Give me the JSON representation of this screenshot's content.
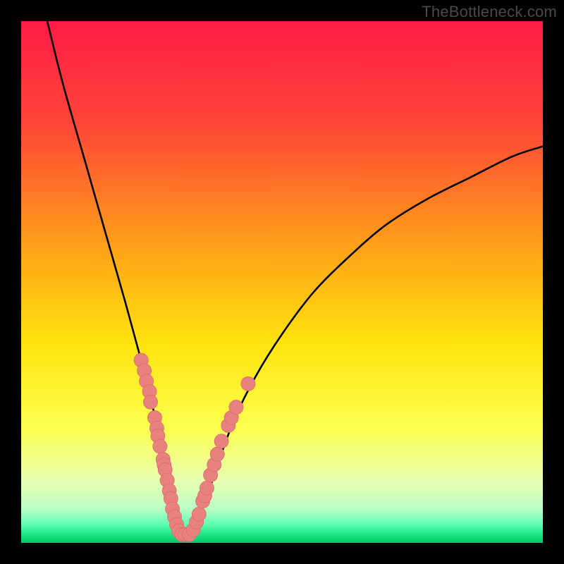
{
  "watermark": {
    "text": "TheBottleneck.com"
  },
  "colors": {
    "frame": "#000000",
    "curve": "#000000",
    "dot_fill": "#e9817f",
    "dot_stroke": "#d86f6d",
    "gradient_stops": [
      {
        "offset": 0.0,
        "color": "#ff1b46"
      },
      {
        "offset": 0.2,
        "color": "#ff4637"
      },
      {
        "offset": 0.45,
        "color": "#ffa716"
      },
      {
        "offset": 0.62,
        "color": "#ffe40f"
      },
      {
        "offset": 0.78,
        "color": "#fbff4e"
      },
      {
        "offset": 0.88,
        "color": "#e9ffb0"
      },
      {
        "offset": 0.935,
        "color": "#b9ffc4"
      },
      {
        "offset": 0.965,
        "color": "#5fffb3"
      },
      {
        "offset": 0.985,
        "color": "#17e57f"
      },
      {
        "offset": 1.0,
        "color": "#00c867"
      }
    ]
  },
  "chart_data": {
    "type": "line",
    "title": "",
    "xlabel": "",
    "ylabel": "",
    "xlim": [
      0,
      100
    ],
    "ylim": [
      0,
      100
    ],
    "series": [
      {
        "name": "bottleneck-curve",
        "x": [
          5,
          8,
          12,
          16,
          20,
          23,
          25,
          27,
          29,
          30,
          31,
          32,
          34,
          36,
          38,
          41,
          45,
          50,
          56,
          63,
          70,
          78,
          86,
          94,
          100
        ],
        "y": [
          100,
          88,
          74,
          60,
          46,
          35,
          27,
          18,
          10,
          5,
          2,
          2,
          5,
          10,
          16,
          24,
          32,
          40,
          48,
          55,
          61,
          66,
          70,
          74,
          76
        ]
      }
    ],
    "annotations": {
      "dots_xy": [
        [
          23.0,
          35.0
        ],
        [
          23.6,
          33.0
        ],
        [
          24.0,
          31.0
        ],
        [
          24.6,
          29.0
        ],
        [
          24.8,
          27.0
        ],
        [
          25.6,
          24.0
        ],
        [
          26.0,
          22.0
        ],
        [
          26.2,
          20.5
        ],
        [
          26.6,
          18.5
        ],
        [
          27.2,
          16.0
        ],
        [
          27.4,
          15.0
        ],
        [
          27.6,
          14.0
        ],
        [
          28.0,
          12.0
        ],
        [
          28.4,
          10.0
        ],
        [
          28.7,
          8.5
        ],
        [
          29.0,
          6.5
        ],
        [
          29.4,
          5.0
        ],
        [
          29.8,
          3.5
        ],
        [
          30.2,
          2.3
        ],
        [
          30.8,
          1.6
        ],
        [
          31.4,
          1.6
        ],
        [
          32.2,
          1.6
        ],
        [
          33.0,
          2.5
        ],
        [
          33.6,
          4.0
        ],
        [
          34.1,
          5.5
        ],
        [
          34.8,
          8.0
        ],
        [
          35.2,
          9.0
        ],
        [
          35.6,
          10.5
        ],
        [
          36.3,
          13.0
        ],
        [
          37.0,
          15.0
        ],
        [
          37.6,
          17.0
        ],
        [
          38.4,
          19.5
        ],
        [
          39.7,
          22.5
        ],
        [
          40.3,
          24.0
        ],
        [
          41.2,
          26.0
        ],
        [
          43.5,
          30.5
        ]
      ],
      "dot_radius": 1.35
    }
  }
}
